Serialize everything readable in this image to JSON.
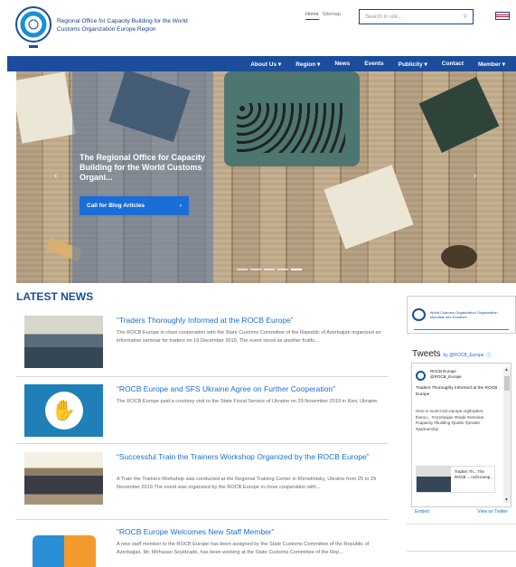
{
  "header": {
    "org_title": "Regional Office for Capacity Building for the World Customs Organization Europe Region",
    "links": [
      "Home",
      "Sitemap"
    ],
    "search_placeholder": "Search in site...",
    "search_icon": "magnifier-icon",
    "flag": "uk-flag-icon"
  },
  "nav": {
    "items": [
      "About Us ▾",
      "Region ▾",
      "News",
      "Events",
      "Publicity ▾",
      "Contact",
      "Member ▾"
    ]
  },
  "hero": {
    "caption": "The Regional Office for Capacity Building for the World Customs Organi...",
    "cta_label": "Call for Blog Articles",
    "cta_arrow": "›",
    "prev": "‹",
    "next": "›"
  },
  "news": {
    "heading": "LATEST NEWS",
    "items": [
      {
        "title": "“Traders Thoroughly Informed at the ROCB Europe”",
        "body": "The ROCB Europe in close cooperation with the State Customs Committee of the Republic of Azerbaijan organized an informative seminar for traders on 19 December 2019. The event stood as another fruitfu..."
      },
      {
        "title": "“ROCB Europe and SFS Ukraine Agree on Further Cooperation”",
        "body": "The ROCB Europe paid a courtesy visit to the State Fiscal Service of Ukraine on 29 November 2019 in Kiev, Ukraine."
      },
      {
        "title": "“Successful Train the Trainers Workshop Organized by the ROCB Europe”",
        "body": "A Train the Trainers Workshop was conducted at the Regional Training Center in Khmelnitsky, Ukraine from 25 to 29 November 2019.The event was organized by the ROCB Europe in close cooperation with..."
      },
      {
        "title": "“ROCB Europe Welcomes New Staff Member”",
        "body": "A new staff member to the ROCB Europe has been assigned by the State Customs Committee of the Republic of Azerbaijan. Mr. Mirhasan Seyidzade, has been working at the State Customs Committee of the Rep..."
      }
    ]
  },
  "sidebar": {
    "wco_text": "World Customs Organization Organisation Mondiale des Douanes",
    "tweets_title": "Tweets",
    "tweets_by": "by @ROCB_Europe",
    "tweet_name": "ROCB Europe",
    "tweet_handle": "@ROCB_Europe",
    "tweet_text": "Traders Thoroughly Informed at the ROCB Europe",
    "tweet_link": "Here is more:rocb-europe.org/traders-thorou... #Azerbaijan #trade #seminar #capacity #building #public #private #partnership",
    "card_text": "Traders Th... The ROCB ... rocb-europ...",
    "embed": "Embed",
    "view": "View on Twitter"
  }
}
